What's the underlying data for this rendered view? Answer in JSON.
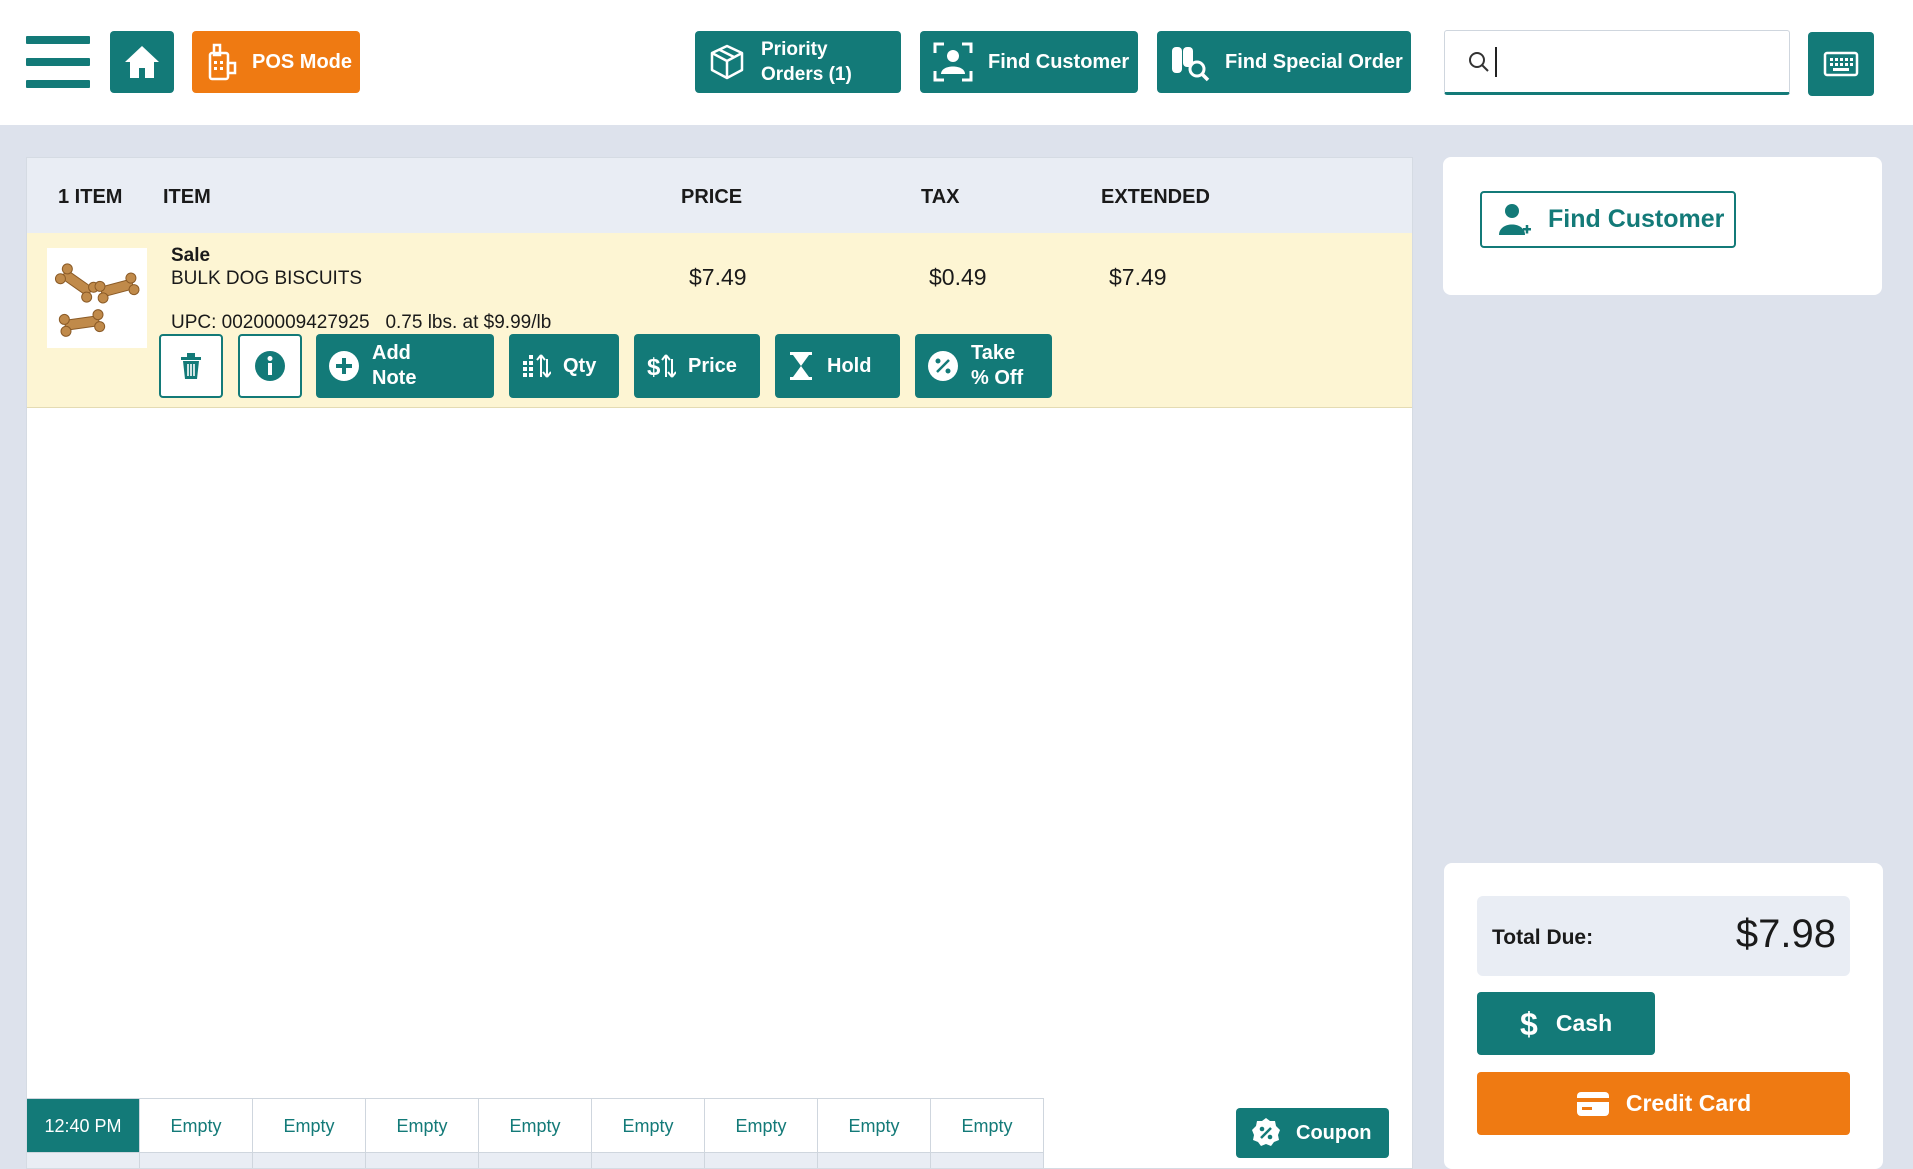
{
  "topbar": {
    "pos_mode_label": "POS Mode",
    "priority_orders_line1": "Priority",
    "priority_orders_line2": "Orders (1)",
    "find_customer_label": "Find Customer",
    "find_special_order_label": "Find Special Order",
    "search_value": ""
  },
  "table": {
    "headers": {
      "count": "1 ITEM",
      "item": "ITEM",
      "price": "PRICE",
      "tax": "TAX",
      "extended": "EXTENDED"
    },
    "rows": [
      {
        "tag": "Sale",
        "name": "BULK DOG BISCUITS",
        "upc_line": "UPC: 00200009427925   0.75 lbs. at $9.99/lb",
        "price": "$7.49",
        "tax": "$0.49",
        "extended": "$7.49"
      }
    ]
  },
  "row_actions": {
    "add_note_line1": "Add",
    "add_note_line2": "Note",
    "qty_label": "Qty",
    "price_label": "Price",
    "hold_label": "Hold",
    "take_off_line1": "Take",
    "take_off_line2": "% Off"
  },
  "tabs": [
    "12:40 PM",
    "Empty",
    "Empty",
    "Empty",
    "Empty",
    "Empty",
    "Empty",
    "Empty",
    "Empty"
  ],
  "coupon_label": "Coupon",
  "side": {
    "find_customer_label": "Find Customer",
    "total_label": "Total Due:",
    "total_amount": "$7.98",
    "cash_label": "Cash",
    "credit_card_label": "Credit Card"
  },
  "colors": {
    "accent": "#137a78",
    "brand_orange": "#ef7a12",
    "row_highlight": "#fdf5d3"
  },
  "icons": [
    "hamburger-icon",
    "home-icon",
    "pos-terminal-icon",
    "package-icon",
    "user-scan-icon",
    "binoculars-search-icon",
    "search-icon",
    "keyboard-icon",
    "trash-icon",
    "info-icon",
    "plus-circle-icon",
    "qty-bars-icon",
    "dollar-arrows-icon",
    "hourglass-icon",
    "percent-icon",
    "coupon-icon",
    "user-plus-icon",
    "dollar-icon",
    "credit-card-icon"
  ]
}
